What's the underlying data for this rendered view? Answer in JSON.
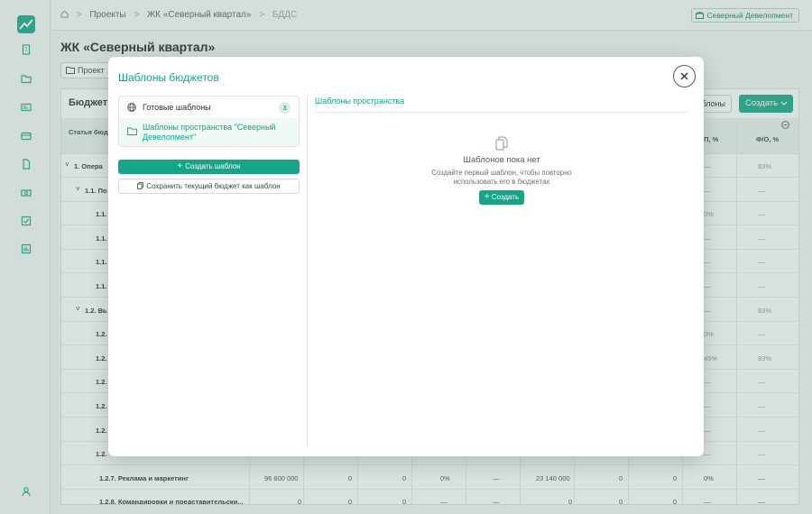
{
  "breadcrumbs": {
    "projects": "Проекты",
    "complex": "ЖК «Северный квартал»",
    "current": "БДДС"
  },
  "organization": "Северный Девелопмент",
  "page": {
    "title": "ЖК «Северный квартал»",
    "project_button": "Проект",
    "panel_title": "Бюджет д",
    "templates_button": "аблоны",
    "create_button": "Создать"
  },
  "table": {
    "header_label": "Статья бюд",
    "col_fp": "/П, %",
    "col_fo": "Ф/О, %",
    "rows": [
      {
        "label": "1. Опера",
        "fp": "—",
        "fo": "83%"
      },
      {
        "label": "1.1. По",
        "fp": "—",
        "fo": "—"
      },
      {
        "label": "1.1.",
        "fp": "0%",
        "fo": "—"
      },
      {
        "label": "1.1.",
        "fp": "—",
        "fo": "—"
      },
      {
        "label": "1.1.",
        "fp": "—",
        "fo": "—"
      },
      {
        "label": "1.1.",
        "fp": "—",
        "fo": "—"
      },
      {
        "label": "1.2. Вь",
        "fp": "—",
        "fo": "83%"
      },
      {
        "label": "1.2.",
        "fp": "0%",
        "fo": "—"
      },
      {
        "label": "1.2.",
        "fp": "45%",
        "fo": "83%"
      },
      {
        "label": "1.2.",
        "fp": "—",
        "fo": "—"
      },
      {
        "label": "1.2.",
        "fp": "—",
        "fo": "—"
      },
      {
        "label": "1.2.",
        "fp": "—",
        "fo": "—"
      },
      {
        "label": "1.2.",
        "fp": "—",
        "fo": "—"
      }
    ],
    "row_marketing": {
      "label": "1.2.7. Реклама и маркетинг",
      "c1": "96 800 000",
      "c2": "0",
      "c3": "0",
      "c4": "0%",
      "c5": "—",
      "c6": "23 140 000",
      "c7": "0",
      "c8": "0",
      "fp": "0%",
      "fo": "—"
    },
    "row_travel": {
      "label": "1.2.8. Командировки и представительски...",
      "c1": "0",
      "c2": "0",
      "c3": "0",
      "c4": "—",
      "c5": "—",
      "c6": "0",
      "c7": "0",
      "c8": "0",
      "fp": "—",
      "fo": "—"
    }
  },
  "modal": {
    "title": "Шаблоны бюджетов",
    "ready_templates": {
      "label": "Готовые шаблоны",
      "count": "3"
    },
    "space_templates": {
      "label": "Шаблоны пространства \"Северный Девелопмент\""
    },
    "create_template_button": "Создать шаблон",
    "save_as_template_button": "Сохранить текущий бюджет как шаблон",
    "section_title": "Шаблоны пространства",
    "empty": {
      "title": "Шаблонов пока нет",
      "desc_line1": "Создайте первый шаблон, чтобы повторно",
      "desc_line2": "использовать его в бюджетах",
      "create_button": "Создать"
    }
  },
  "colors": {
    "accent": "#17a589",
    "accent_light": "#eef8f5"
  }
}
